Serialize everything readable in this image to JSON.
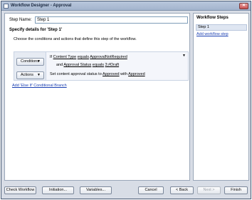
{
  "window": {
    "title": "Workflow Designer - Approval",
    "close_glyph": "✕"
  },
  "step": {
    "label": "Step Name:",
    "value": "Step 1"
  },
  "main": {
    "specify_header": "Specify details for 'Step 1'",
    "choose_text": "Choose the conditions and actions that define this step of the workflow.",
    "conditions_button": "Conditions",
    "actions_button": "Actions",
    "dropdown_glyph": "▼",
    "condition_line1": {
      "prefix": "If",
      "field": "Content Type",
      "op": "equals",
      "value": "ApprovalNotRequired"
    },
    "condition_line2": {
      "prefix": "and",
      "field": "Approval Status",
      "op": "equals",
      "value": "3;#Draft"
    },
    "action_line": {
      "text1": "Set content approval status to",
      "status": "Approved",
      "text2": "with",
      "comment": "Approved"
    },
    "add_else_link": "Add 'Else If' Conditional Branch"
  },
  "side": {
    "title": "Workflow Steps",
    "steps": [
      "Step 1"
    ],
    "add_link": "Add workflow step"
  },
  "footer": {
    "check_workflow": "Check Workflow",
    "initiation": "Initiation...",
    "variables": "Variables...",
    "cancel": "Cancel",
    "back": "< Back",
    "next": "Next >",
    "finish": "Finish"
  }
}
